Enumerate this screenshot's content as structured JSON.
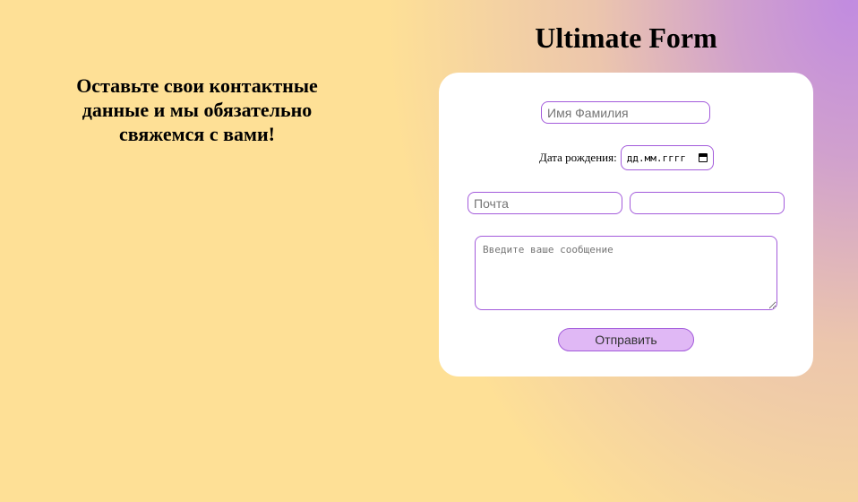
{
  "header": {
    "title": "Ultimate Form"
  },
  "intro": {
    "message": "Оставьте свои контактные данные и мы обязательно свяжемся с вами!"
  },
  "form": {
    "name": {
      "placeholder": "Имя Фамилия",
      "value": ""
    },
    "birthdate": {
      "label": "Дата рождения:",
      "placeholder_text": "дд.мм.гггг",
      "icon": "calendar-icon"
    },
    "email": {
      "placeholder": "Почта",
      "value": ""
    },
    "phone": {
      "placeholder": "",
      "value": ""
    },
    "message": {
      "placeholder": "Введите ваше сообщение",
      "value": ""
    },
    "submit_label": "Отправить"
  },
  "colors": {
    "background_warm": "#fee096",
    "background_accent": "#c18be0",
    "input_border": "#a35bdb",
    "button_fill": "#e0b8f5",
    "card": "#ffffff"
  }
}
